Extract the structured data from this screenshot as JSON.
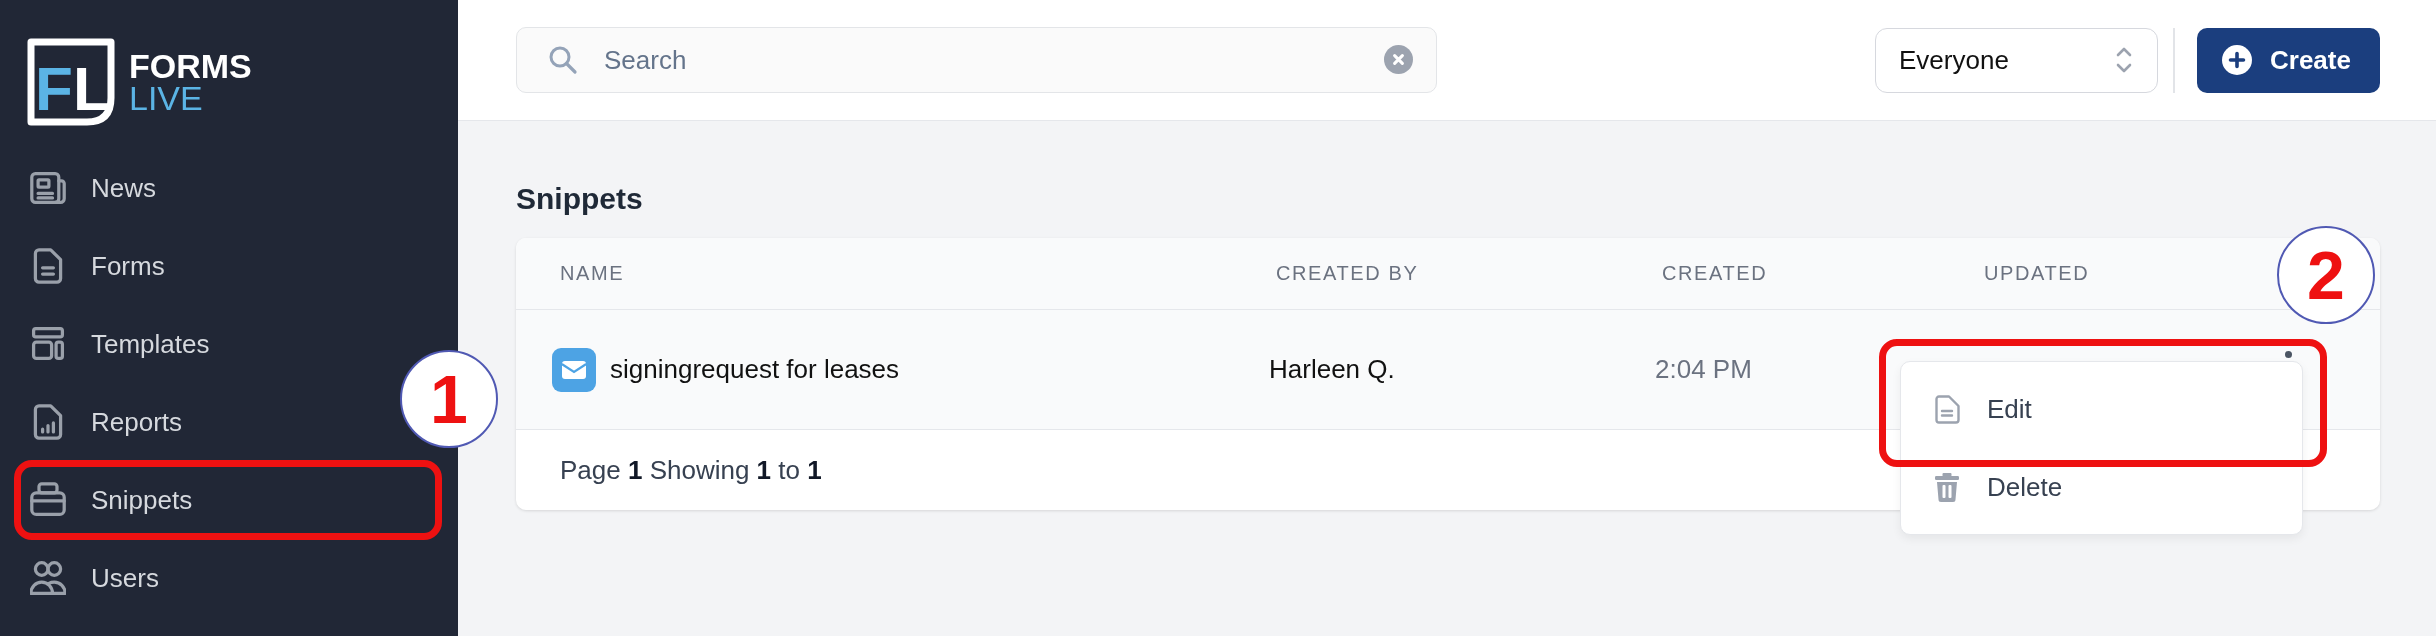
{
  "sidebar": {
    "logo": {
      "mark": [
        "F",
        "L"
      ],
      "title": "FORMS",
      "subtitle": "LIVE"
    },
    "items": [
      {
        "label": "News",
        "highlighted": false
      },
      {
        "label": "Forms",
        "highlighted": false
      },
      {
        "label": "Templates",
        "highlighted": false
      },
      {
        "label": "Reports",
        "highlighted": false
      },
      {
        "label": "Snippets",
        "highlighted": true
      },
      {
        "label": "Users",
        "highlighted": false
      }
    ],
    "callout": "1"
  },
  "topbar": {
    "search": {
      "placeholder": "Search"
    },
    "filter": {
      "value": "Everyone"
    },
    "create_button": {
      "label": "Create"
    }
  },
  "page": {
    "title": "Snippets",
    "table": {
      "columns": [
        "NAME",
        "CREATED BY",
        "CREATED",
        "UPDATED"
      ],
      "rows": [
        {
          "kind": "email",
          "name": "signingrequest for leases",
          "created_by": "Harleen Q.",
          "created": "2:04 PM"
        }
      ],
      "footer": "Page **1** Showing **1** to **1**"
    },
    "row_menu": {
      "items": [
        {
          "label": "Edit",
          "highlighted": true
        },
        {
          "label": "Delete",
          "highlighted": false
        }
      ],
      "callout": "2"
    }
  }
}
